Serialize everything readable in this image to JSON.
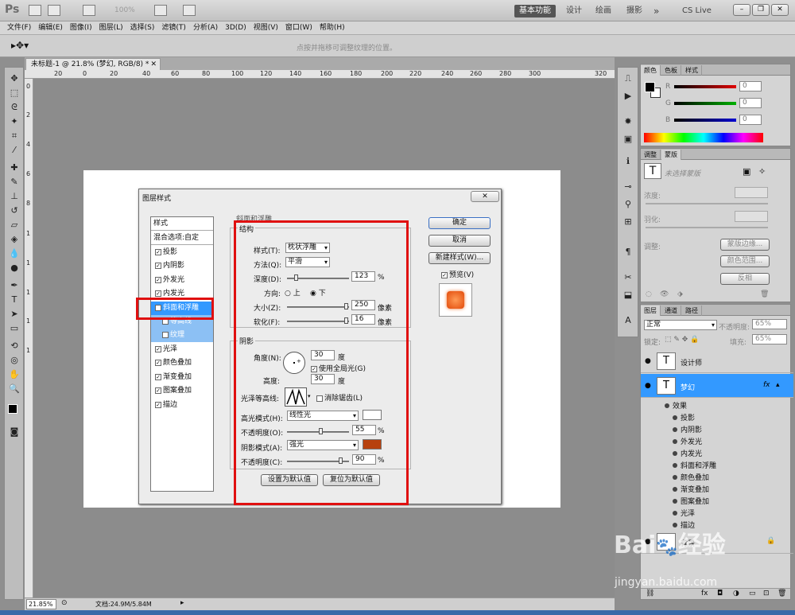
{
  "app": {
    "logo": "Ps",
    "zoom": "100%",
    "workspaces": [
      "基本功能",
      "设计",
      "绘画",
      "摄影"
    ],
    "more": "»",
    "cslive": "CS Live"
  },
  "menu": [
    "文件(F)",
    "编辑(E)",
    "图像(I)",
    "图层(L)",
    "选择(S)",
    "滤镜(T)",
    "分析(A)",
    "3D(D)",
    "视图(V)",
    "窗口(W)",
    "帮助(H)"
  ],
  "options": {
    "hint": "点按并拖移可调整纹理的位置。"
  },
  "document": {
    "tab_title": "未标题-1 @ 21.8% (梦幻, RGB/8) *",
    "ruler_marks": [
      "20",
      "0",
      "20",
      "40",
      "60",
      "80",
      "100",
      "120",
      "140",
      "160",
      "180",
      "200",
      "220",
      "240",
      "260",
      "280",
      "300",
      "320"
    ],
    "ruler_v_marks": [
      "0",
      "2",
      "4",
      "6",
      "8",
      "1",
      "1",
      "1",
      "1",
      "1"
    ],
    "zoom": "21.85%",
    "info": "文档:24.9M/5.84M"
  },
  "dialog": {
    "title": "图层样式",
    "close": "✕",
    "style_header": "样式",
    "blend_options": "混合选项:自定",
    "styles": [
      {
        "label": "投影",
        "checked": true
      },
      {
        "label": "内阴影",
        "checked": true
      },
      {
        "label": "外发光",
        "checked": true
      },
      {
        "label": "内发光",
        "checked": true
      },
      {
        "label": "斜面和浮雕",
        "checked": true
      },
      {
        "label": "等高线",
        "checked": false
      },
      {
        "label": "纹理",
        "checked": true
      },
      {
        "label": "光泽",
        "checked": true
      },
      {
        "label": "颜色叠加",
        "checked": true
      },
      {
        "label": "渐变叠加",
        "checked": true
      },
      {
        "label": "图案叠加",
        "checked": true
      },
      {
        "label": "描边",
        "checked": true
      }
    ],
    "section_title": "斜面和浮雕",
    "structure": {
      "legend": "结构",
      "style_label": "样式(T):",
      "style_value": "枕状浮雕",
      "method_label": "方法(Q):",
      "method_value": "平滑",
      "depth_label": "深度(D):",
      "depth_value": "123",
      "depth_unit": "%",
      "depth_level": 0.12,
      "direction_label": "方向:",
      "dir_up": "上",
      "dir_down": "下",
      "size_label": "大小(Z):",
      "size_value": "250",
      "size_unit": "像素",
      "size_level": 1.0,
      "soften_label": "软化(F):",
      "soften_value": "16",
      "soften_unit": "像素",
      "soften_level": 1.0
    },
    "shading": {
      "legend": "阴影",
      "angle_label": "角度(N):",
      "angle_value": "30",
      "angle_unit": "度",
      "global_light": "使用全局光(G)",
      "altitude_label": "高度:",
      "altitude_value": "30",
      "altitude_unit": "度",
      "gloss_label": "光泽等高线:",
      "anti_alias": "消除锯齿(L)",
      "highlight_label": "高光模式(H):",
      "highlight_value": "线性光",
      "highlight_color": "#ffffff",
      "hl_opacity_label": "不透明度(O):",
      "hl_opacity_value": "55",
      "hl_opacity_unit": "%",
      "hl_opacity_level": 0.55,
      "shadow_label": "阴影模式(A):",
      "shadow_value": "强光",
      "shadow_color": "#b7410e",
      "sh_opacity_label": "不透明度(C):",
      "sh_opacity_value": "90",
      "sh_opacity_unit": "%",
      "sh_opacity_level": 0.9
    },
    "make_default": "设置为默认值",
    "reset_default": "复位为默认值",
    "ok": "确定",
    "cancel": "取消",
    "new_style": "新建样式(W)...",
    "preview": "预览(V)"
  },
  "panels": {
    "color_tabs": [
      "颜色",
      "色板",
      "样式"
    ],
    "rgb": [
      {
        "ch": "R",
        "val": "0"
      },
      {
        "ch": "G",
        "val": "0"
      },
      {
        "ch": "B",
        "val": "0"
      }
    ],
    "adjust_tabs": [
      "调整",
      "蒙版"
    ],
    "mask_title": "未选择蒙版",
    "density": "浓度:",
    "feather": "羽化:",
    "refine": "调整:",
    "mask_edge": "蒙版边缘...",
    "color_range": "颜色范围...",
    "invert": "反相",
    "layers_tabs": [
      "图层",
      "通道",
      "路径"
    ],
    "blend_mode": "正常",
    "opacity_label": "不透明度:",
    "opacity_value": "65%",
    "lock_label": "锁定:",
    "fill_label": "填充:",
    "fill_value": "65%",
    "layers": [
      {
        "name": "设计师",
        "type": "T"
      },
      {
        "name": "梦幻",
        "type": "T",
        "fx": "fx"
      }
    ],
    "effects_label": "效果",
    "effects": [
      "投影",
      "内阴影",
      "外发光",
      "内发光",
      "斜面和浮雕",
      "颜色叠加",
      "渐变叠加",
      "图案叠加",
      "光泽",
      "描边"
    ],
    "bg_layer": "背景"
  },
  "watermark": {
    "brand": "Bai",
    "brand2": "经验",
    "url": "jingyan.baidu.com"
  }
}
